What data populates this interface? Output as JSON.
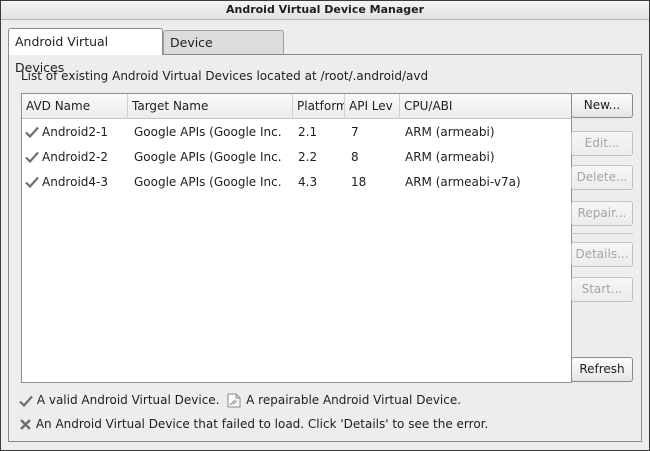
{
  "window": {
    "title": "Android Virtual Device Manager"
  },
  "tabs": [
    {
      "label": "Android Virtual Devices",
      "selected": true
    },
    {
      "label": "Device Definitions",
      "selected": false
    }
  ],
  "avd_panel": {
    "description": "List of existing Android Virtual Devices located at /root/.android/avd",
    "columns": [
      "AVD Name",
      "Target Name",
      "Platform",
      "API Lev",
      "CPU/ABI"
    ],
    "rows": [
      {
        "name": "Android2-1",
        "target": "Google APIs (Google Inc.",
        "platform": "2.1",
        "api": "7",
        "cpu": "ARM (armeabi)",
        "status_icon": "valid-check-icon"
      },
      {
        "name": "Android2-2",
        "target": "Google APIs (Google Inc.",
        "platform": "2.2",
        "api": "8",
        "cpu": "ARM (armeabi)",
        "status_icon": "valid-check-icon"
      },
      {
        "name": "Android4-3",
        "target": "Google APIs (Google Inc.",
        "platform": "4.3",
        "api": "18",
        "cpu": "ARM (armeabi-v7a)",
        "status_icon": "valid-check-icon"
      }
    ]
  },
  "buttons": {
    "new": "New...",
    "edit": "Edit...",
    "delete": "Delete...",
    "repair": "Repair...",
    "details": "Details...",
    "start": "Start...",
    "refresh": "Refresh"
  },
  "legend": {
    "valid": "A valid Android Virtual Device.",
    "repairable": "A repairable Android Virtual Device.",
    "failed": "An Android Virtual Device that failed to load. Click 'Details' to see the error."
  },
  "colors": {
    "check": "#6e6e6e",
    "disabled_text": "#a5a5a5",
    "window_bg": "#ededed"
  }
}
